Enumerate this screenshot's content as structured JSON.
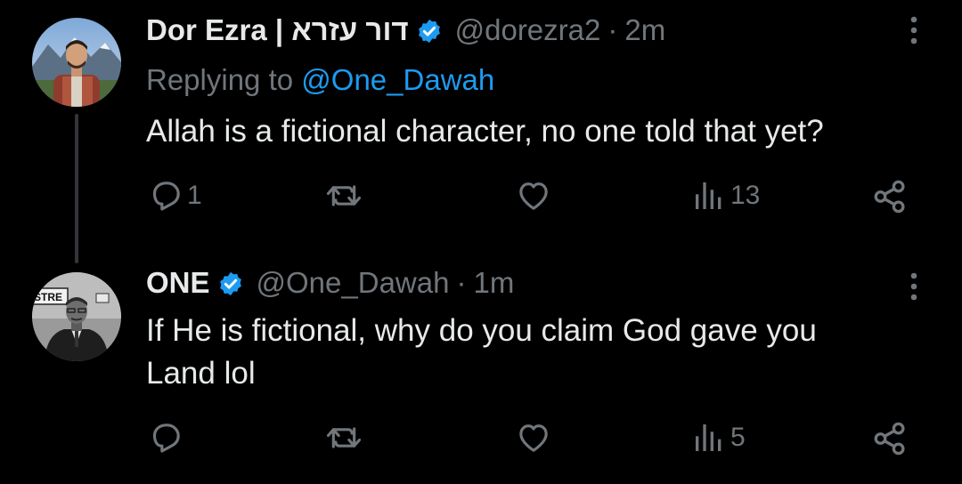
{
  "tweets": [
    {
      "display_name": "Dor Ezra | דור עזרא",
      "handle": "@dorezra2",
      "separator": "·",
      "time": "2m",
      "replying_prefix": "Replying to",
      "replying_to": "@One_Dawah",
      "text": "Allah is a fictional character, no one told that yet?",
      "reply_count": "1",
      "views": "13"
    },
    {
      "display_name": "ONE",
      "handle": "@One_Dawah",
      "separator": "·",
      "time": "1m",
      "text_line1": "If He is fictional, why do you claim God gave you",
      "text_line2": "Land lol",
      "views": "5"
    }
  ],
  "avatar_sign_text": "STRE",
  "colors": {
    "background": "#000000",
    "text": "#e7e9ea",
    "muted": "#71767b",
    "link": "#1d9bf0",
    "verified_badge": "#1d9bf0",
    "thread_line": "#333639"
  },
  "icons": [
    "reply-icon",
    "retweet-icon",
    "like-icon",
    "views-icon",
    "share-icon",
    "more-icon",
    "verified-badge-icon"
  ]
}
